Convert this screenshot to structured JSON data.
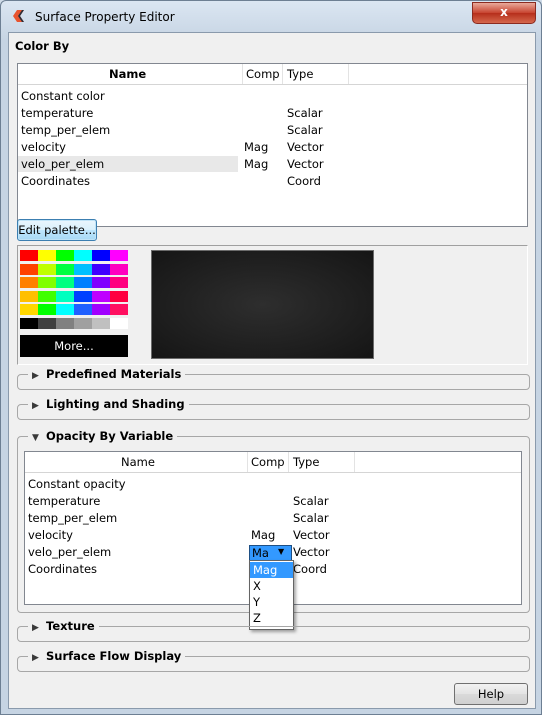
{
  "window": {
    "title": "Surface Property Editor",
    "close_label": "x"
  },
  "color_by": {
    "section_label": "Color By",
    "columns": {
      "name": "Name",
      "comp": "Comp",
      "type": "Type"
    },
    "rows": [
      {
        "name": "Constant color",
        "comp": "",
        "type": ""
      },
      {
        "name": "temperature",
        "comp": "",
        "type": "Scalar"
      },
      {
        "name": "temp_per_elem",
        "comp": "",
        "type": "Scalar"
      },
      {
        "name": "velocity",
        "comp": "Mag",
        "type": "Vector"
      },
      {
        "name": "velo_per_elem",
        "comp": "Mag",
        "type": "Vector"
      },
      {
        "name": "Coordinates",
        "comp": "",
        "type": "Coord"
      }
    ]
  },
  "edit_palette_label": "Edit palette...",
  "palette": {
    "more_label": "More...",
    "colors": [
      [
        "#ff0000",
        "#ffff00",
        "#00ff00",
        "#00ffff",
        "#0000ff",
        "#ff00ff"
      ],
      [
        "#ff4000",
        "#c0ff00",
        "#00ff40",
        "#00c0ff",
        "#4000ff",
        "#ff00c0"
      ],
      [
        "#ff8000",
        "#80ff00",
        "#00ff80",
        "#0080ff",
        "#8000ff",
        "#ff0080"
      ],
      [
        "#ffbf00",
        "#40ff00",
        "#00ffbf",
        "#0040ff",
        "#bf00ff",
        "#ff0040"
      ],
      [
        "#ffd700",
        "#00ff00",
        "#00ffff",
        "#2060ff",
        "#a000ff",
        "#ff1060"
      ],
      [
        "#000000",
        "#404040",
        "#808080",
        "#a0a0a0",
        "#c0c0c0",
        "#ffffff"
      ]
    ]
  },
  "groups": {
    "predefined": "Predefined Materials",
    "lighting": "Lighting and Shading",
    "opacity": "Opacity By Variable",
    "texture": "Texture",
    "flow": "Surface Flow Display"
  },
  "opacity_by": {
    "columns": {
      "name": "Name",
      "comp": "Comp",
      "type": "Type"
    },
    "rows": [
      {
        "name": "Constant opacity",
        "comp": "",
        "type": ""
      },
      {
        "name": "temperature",
        "comp": "",
        "type": "Scalar"
      },
      {
        "name": "temp_per_elem",
        "comp": "",
        "type": "Scalar"
      },
      {
        "name": "velocity",
        "comp": "Mag",
        "type": "Vector"
      },
      {
        "name": "velo_per_elem",
        "comp": "",
        "type": "Vector"
      },
      {
        "name": "Coordinates",
        "comp": "",
        "type": "Coord"
      }
    ],
    "combo_value": "Ma",
    "dropdown_options": [
      "Mag",
      "X",
      "Y",
      "Z"
    ],
    "dropdown_selected": "Mag"
  },
  "help_label": "Help"
}
